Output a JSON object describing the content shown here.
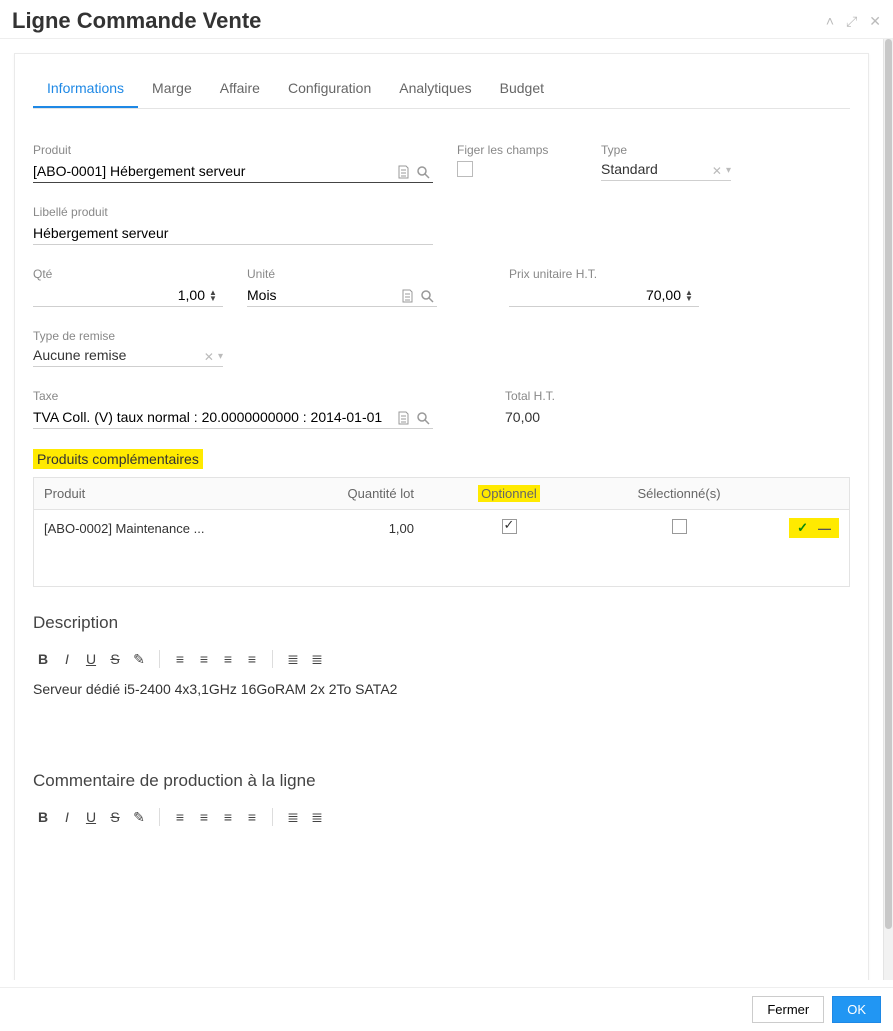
{
  "dialog": {
    "title": "Ligne Commande Vente"
  },
  "tabs": {
    "items": [
      "Informations",
      "Marge",
      "Affaire",
      "Configuration",
      "Analytiques",
      "Budget"
    ],
    "active_index": 0
  },
  "labels": {
    "produit": "Produit",
    "figer": "Figer les champs",
    "type": "Type",
    "libelle": "Libellé produit",
    "qte": "Qté",
    "unite": "Unité",
    "prixu": "Prix unitaire H.T.",
    "type_remise": "Type de remise",
    "taxe": "Taxe",
    "total_ht": "Total H.T."
  },
  "values": {
    "produit": "[ABO-0001] Hébergement serveur",
    "type": "Standard",
    "libelle": "Hébergement serveur",
    "qte": "1,00",
    "unite": "Mois",
    "prixu": "70,00",
    "type_remise": "Aucune remise",
    "taxe": "TVA Coll. (V) taux normal : 20.0000000000 : 2014-01-01",
    "total_ht": "70,00"
  },
  "complementary": {
    "title": "Produits complémentaires",
    "columns": {
      "produit": "Produit",
      "qty": "Quantité lot",
      "opt": "Optionnel",
      "sel": "Sélectionné(s)"
    },
    "rows": [
      {
        "produit": "[ABO-0002] Maintenance ...",
        "qty": "1,00",
        "optional": true,
        "selected": false
      }
    ]
  },
  "description": {
    "title": "Description",
    "text": "Serveur dédié i5-2400 4x3,1GHz 16GoRAM 2x 2To SATA2"
  },
  "prod_comment": {
    "title": "Commentaire de production à la ligne",
    "text": ""
  },
  "footer": {
    "close": "Fermer",
    "ok": "OK"
  }
}
